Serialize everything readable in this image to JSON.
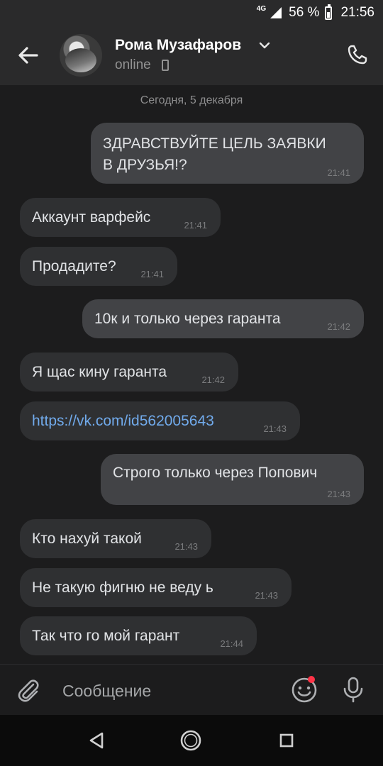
{
  "status_bar": {
    "network": "4G",
    "battery": "56 %",
    "time": "21:56"
  },
  "header": {
    "name": "Рома Музафаров",
    "status": "online",
    "icons": [
      "arrow-left-icon",
      "chevron-down-icon",
      "mobile-icon",
      "phone-icon"
    ]
  },
  "chat": {
    "date": "Сегодня, 5 декабря",
    "messages": [
      {
        "dir": "out",
        "text": "ЗДРАВСТВУЙТЕ ЦЕЛЬ ЗАЯВКИ\nВ ДРУЗЬЯ!?",
        "time": "21:41"
      },
      {
        "dir": "in",
        "text": "Аккаунт варфейс",
        "time": "21:41"
      },
      {
        "dir": "in",
        "text": "Продадите?",
        "time": "21:41"
      },
      {
        "dir": "out",
        "text": "10к и только через гаранта",
        "time": "21:42"
      },
      {
        "dir": "in",
        "text": "Я щас кину гаранта",
        "time": "21:42"
      },
      {
        "dir": "in",
        "text": "https://vk.com/id562005643",
        "time": "21:43",
        "is_link": true
      },
      {
        "dir": "out",
        "text": "Строго только через Попович",
        "time": "21:43"
      },
      {
        "dir": "in",
        "text": "Кто нахуй такой",
        "time": "21:43"
      },
      {
        "dir": "in",
        "text": "Не такую фигню не веду ь",
        "time": "21:43"
      },
      {
        "dir": "in",
        "text": "Так что го мой гарант",
        "time": "21:44"
      }
    ]
  },
  "composer": {
    "placeholder": "Сообщение",
    "icons": [
      "paperclip-icon",
      "emoji-icon",
      "microphone-icon"
    ]
  },
  "colors": {
    "background": "#1c1c1d",
    "bubble_in": "#2f3032",
    "bubble_out": "#424346",
    "link": "#71aaeb",
    "badge_dot": "#ff3347"
  }
}
